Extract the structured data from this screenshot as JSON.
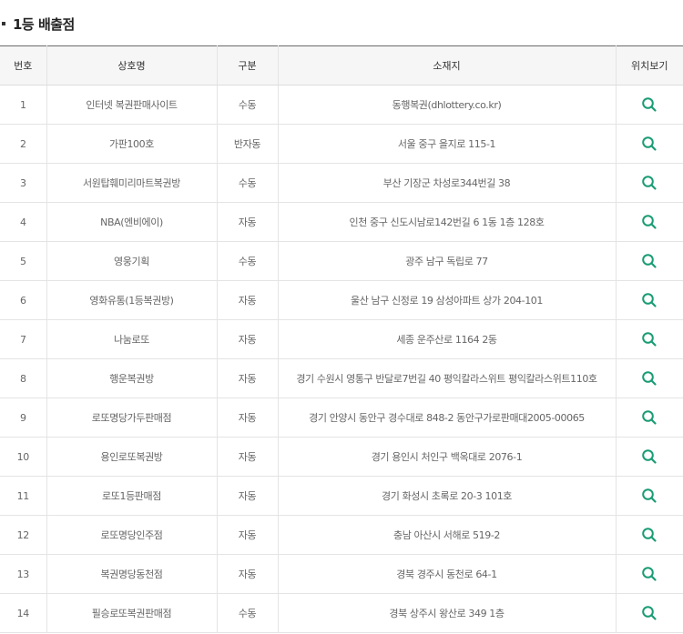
{
  "section_title": "1등 배출점",
  "columns": {
    "no": "번호",
    "shop": "상호명",
    "type": "구분",
    "address": "소재지",
    "map": "위치보기"
  },
  "colors": {
    "search_icon": "#1a9c74",
    "header_bg": "#f6f6f6"
  },
  "map_icon": "search-icon",
  "rows": [
    {
      "no": "1",
      "shop": "인터넷 복권판매사이트",
      "type": "수동",
      "address": "동행복권(dhlottery.co.kr)"
    },
    {
      "no": "2",
      "shop": "가판100호",
      "type": "반자동",
      "address": "서울 중구 을지로 115-1"
    },
    {
      "no": "3",
      "shop": "서원탑훼미리마트복권방",
      "type": "수동",
      "address": "부산 기장군 차성로344번길 38"
    },
    {
      "no": "4",
      "shop": "NBA(엔비에이)",
      "type": "자동",
      "address": "인천 중구 신도시남로142번길 6 1동 1층 128호"
    },
    {
      "no": "5",
      "shop": "영웅기획",
      "type": "수동",
      "address": "광주 남구 독립로 77"
    },
    {
      "no": "6",
      "shop": "영화유통(1등복권방)",
      "type": "자동",
      "address": "울산 남구 신정로 19 삼성아파트 상가 204-101"
    },
    {
      "no": "7",
      "shop": "나눔로또",
      "type": "자동",
      "address": "세종 운주산로 1164 2동"
    },
    {
      "no": "8",
      "shop": "행운복권방",
      "type": "자동",
      "address": "경기 수원시 영통구 반달로7번길 40 평익칼라스위트 평익칼라스위트110호"
    },
    {
      "no": "9",
      "shop": "로또명당가두판매점",
      "type": "자동",
      "address": "경기 안양시 동안구 경수대로 848-2 동안구가로판매대2005-00065"
    },
    {
      "no": "10",
      "shop": "용인로또복권방",
      "type": "자동",
      "address": "경기 용인시 처인구 백옥대로 2076-1"
    },
    {
      "no": "11",
      "shop": "로또1등판매점",
      "type": "자동",
      "address": "경기 화성시 초록로 20-3 101호"
    },
    {
      "no": "12",
      "shop": "로또명당인주점",
      "type": "자동",
      "address": "충남 아산시 서해로 519-2"
    },
    {
      "no": "13",
      "shop": "복권명당동천점",
      "type": "자동",
      "address": "경북 경주시 동천로 64-1"
    },
    {
      "no": "14",
      "shop": "필승로또복권판매점",
      "type": "수동",
      "address": "경북 상주시 왕산로 349 1층"
    }
  ]
}
